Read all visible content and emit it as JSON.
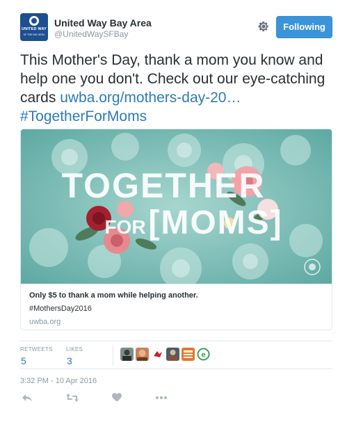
{
  "account": {
    "name": "United Way Bay Area",
    "handle": "@UnitedWaySFBay",
    "avatar_text_line1": "UNITED WAY",
    "avatar_text_line2": "OF THE BAY AREA"
  },
  "header": {
    "follow_label": "Following",
    "gear_icon": "gear-icon"
  },
  "tweet": {
    "text_plain": "This Mother's Day, thank a mom you know and help one you don't. Check out our eye-catching cards",
    "link_text": "uwba.org/mothers-day-20…",
    "hashtag": "#TogetherForMoms"
  },
  "card": {
    "image_text_line1": "TOGETHER",
    "image_text_line2": "FOR",
    "image_text_line3": "[MOMS]",
    "title": "Only $5 to thank a mom while helping another.",
    "description": "#MothersDay2016",
    "domain": "uwba.org"
  },
  "stats": {
    "retweets_label": "RETWEETS",
    "retweets_value": "5",
    "likes_label": "LIKES",
    "likes_value": "3"
  },
  "timestamp": "3:32 PM - 10 Apr 2016",
  "colors": {
    "link": "#2b7bb9",
    "follow_button": "#3b94d9",
    "muted": "#8899a6",
    "card_bg": "#6fb7b1"
  },
  "actions": [
    "reply-icon",
    "retweet-icon",
    "like-icon",
    "more-icon"
  ]
}
